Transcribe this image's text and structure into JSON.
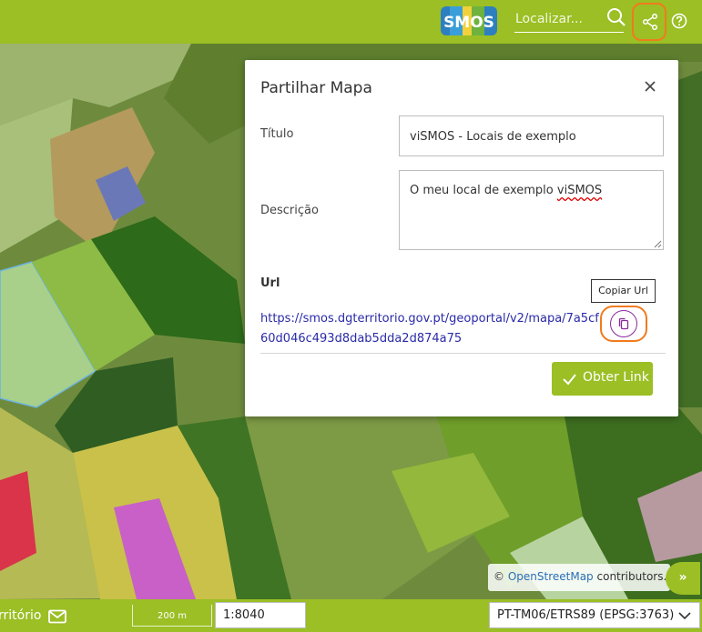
{
  "header": {
    "logo_text": "SMOS",
    "search_placeholder": "Localizar..."
  },
  "modal": {
    "title": "Partilhar Mapa",
    "title_label": "Título",
    "title_value": "viSMOS - Locais de exemplo",
    "description_label": "Descrição",
    "description_value_prefix": "O meu local de exemplo ",
    "description_value_misspelled": "viSMOS",
    "url_label": "Url",
    "url_value": "https://smos.dgterritorio.gov.pt/geoportal/v2/mapa/7a5cf60d046c493d8dab5dda2d874a75",
    "copy_tooltip": "Copiar Url",
    "get_link_label": "Obter Link"
  },
  "attribution": {
    "prefix": "©",
    "link": "OpenStreetMap",
    "suffix": "contributors."
  },
  "footer": {
    "brand_partial": "rritório",
    "scale_bar_label": "200 m",
    "scale_value": "1:8040",
    "projection": "PT-TM06/ETRS89 (EPSG:3763)"
  },
  "colors": {
    "brand_green": "#9bbf24",
    "highlight_orange": "#f07b1e",
    "copy_purple": "#8a2a9c",
    "link_blue": "#2a2aa8"
  }
}
